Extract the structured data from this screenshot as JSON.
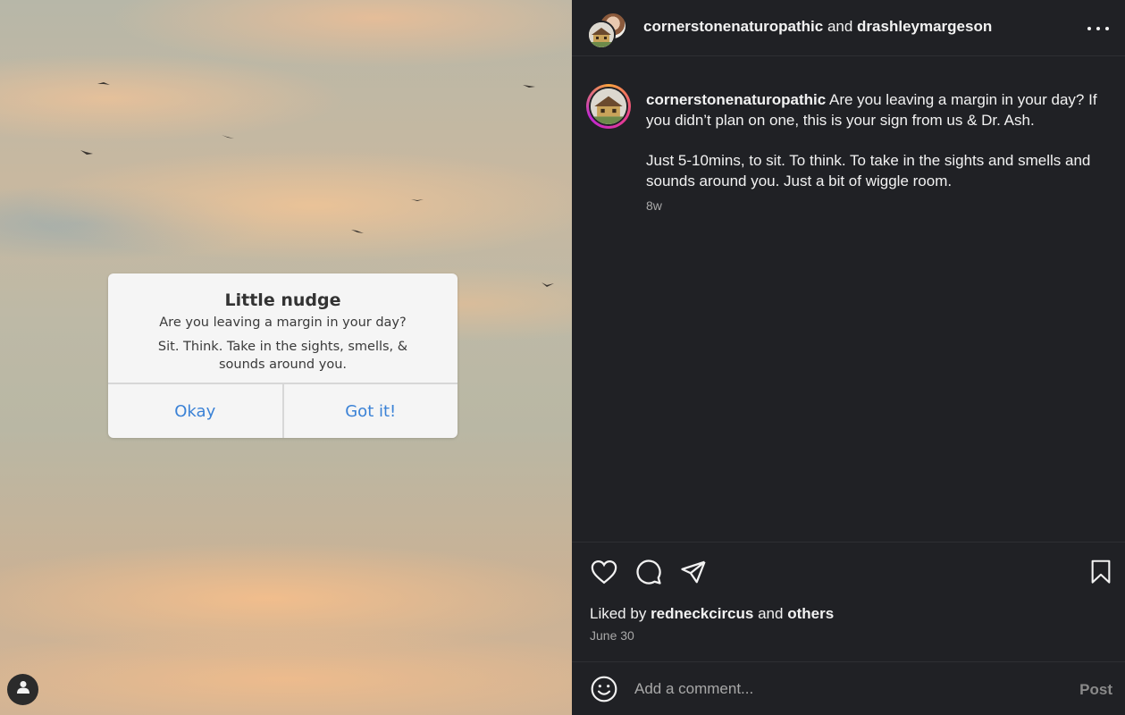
{
  "dialog": {
    "title": "Little nudge",
    "line1": "Are you leaving a margin in your day?",
    "line2": "Sit. Think. Take in the sights, smells, & sounds around you.",
    "button_left": "Okay",
    "button_right": "Got it!"
  },
  "header": {
    "user1": "cornerstonenaturopathic",
    "conjunction": "and",
    "user2": "drashleymargeson"
  },
  "caption": {
    "username": "cornerstonenaturopathic",
    "text1": "Are you leaving a margin in your day? If you didn’t plan on one, this is your sign from us & Dr. Ash.",
    "text2": "Just 5-10mins, to sit. To think. To take in the sights and smells and sounds around you. Just a bit of wiggle room.",
    "time": "8w"
  },
  "likes": {
    "prefix": "Liked by",
    "user": "redneckcircus",
    "conjunction": "and",
    "others": "others"
  },
  "date": "June 30",
  "comment": {
    "placeholder": "Add a comment...",
    "post_label": "Post"
  },
  "icons": [
    "heart-icon",
    "comment-icon",
    "share-icon",
    "bookmark-icon",
    "emoji-icon",
    "more-icon",
    "user-icon"
  ]
}
